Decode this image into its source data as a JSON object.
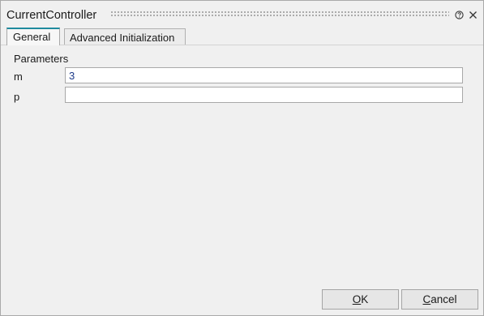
{
  "window": {
    "title": "CurrentController"
  },
  "tabs": [
    {
      "label": "General",
      "active": true
    },
    {
      "label": "Advanced Initialization",
      "active": false
    }
  ],
  "parameters": {
    "section_title": "Parameters",
    "fields": [
      {
        "label": "m",
        "value": "3"
      },
      {
        "label": "p",
        "value": ""
      }
    ]
  },
  "buttons": {
    "ok": {
      "mnemonic": "O",
      "rest": "K"
    },
    "cancel": {
      "mnemonic": "C",
      "rest": "ancel"
    }
  },
  "icons": {
    "help": "help-icon",
    "close": "close-icon"
  },
  "colors": {
    "active_tab_accent": "#1f8a9e",
    "value_text": "#1f3c8a"
  }
}
